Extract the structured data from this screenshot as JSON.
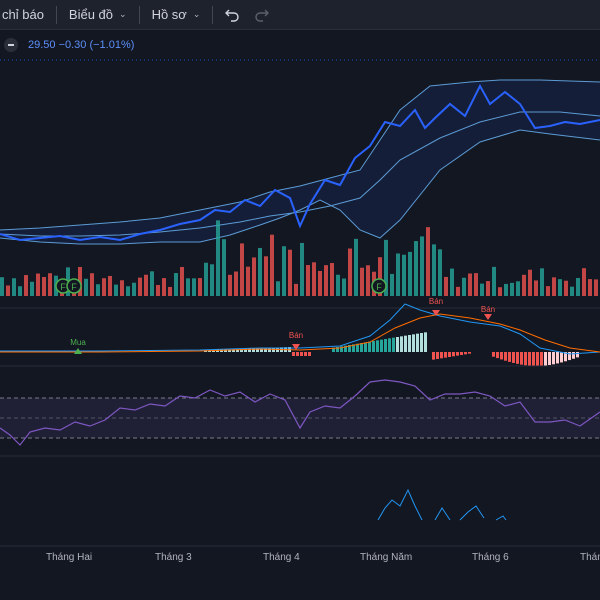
{
  "toolbar": {
    "indicators_label": "chỉ báo",
    "chart_menu_label": "Biểu đồ",
    "profile_menu_label": "Hồ sơ"
  },
  "legend": {
    "price_change": "29.50  −0.30 (−1.01%)"
  },
  "markers": {
    "buy": "Mua",
    "sell_1": "Bán",
    "sell_2": "Bán",
    "sell_3": "Bán",
    "event": "F"
  },
  "time_axis": [
    "Tháng Hai",
    "Tháng 3",
    "Tháng 4",
    "Tháng Năm",
    "Tháng 6",
    "Tháng"
  ],
  "colors": {
    "background": "#131722",
    "price_line": "#2962ff",
    "bollinger": "#5b9bd5",
    "volume_up": "#26a69a",
    "volume_down": "#ef5350",
    "macd": "#2196f3",
    "signal": "#ff6d00",
    "rsi": "#7e57c2",
    "event_marker": "#4caf50"
  },
  "chart_data": {
    "type": "line",
    "x": [
      "Tháng Hai",
      "Tháng 3",
      "Tháng 4",
      "Tháng Năm",
      "Tháng 6"
    ],
    "series": [
      {
        "values": [
          0.18,
          0.2,
          0.22,
          0.25,
          0.3,
          0.34,
          0.36,
          0.42,
          0.52,
          0.6,
          0.78,
          0.95,
          0.9,
          0.88,
          0.8,
          0.86
        ]
      }
    ]
  }
}
